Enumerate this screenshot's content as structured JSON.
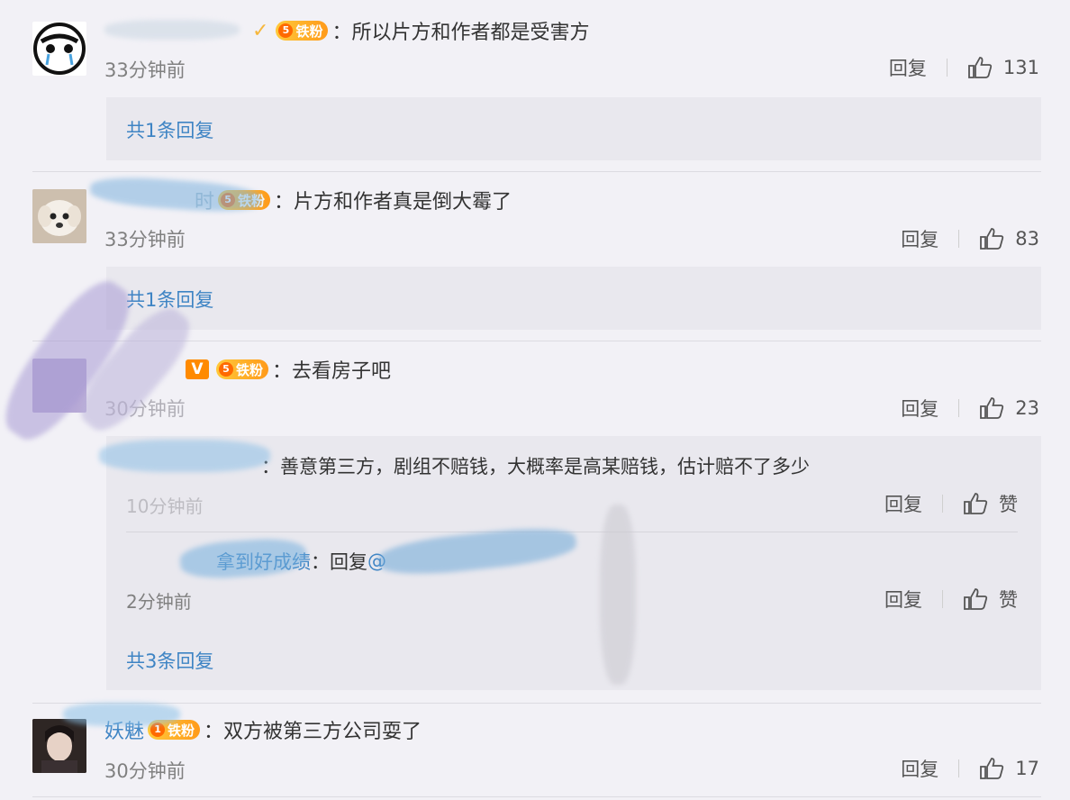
{
  "colors": {
    "link": "#3e84c4",
    "username": "#eb7350",
    "time": "#808080",
    "fan_badge": "#ffa020"
  },
  "comments": [
    {
      "username": "",
      "username_partial": "",
      "badges": {
        "verified_check": true,
        "fan_level": "5",
        "fan_label": "铁粉"
      },
      "text": "：所以片方和作者都是受害方",
      "time": "33分钟前",
      "reply_label": "回复",
      "likes": "131",
      "reply_count": "共1条回复"
    },
    {
      "username": "时",
      "badges": {
        "fan_level": "5",
        "fan_label": "铁粉"
      },
      "text": "：片方和作者真是倒大霉了",
      "time": "33分钟前",
      "reply_label": "回复",
      "likes": "83",
      "reply_count": "共1条回复"
    },
    {
      "username": "",
      "badges": {
        "vip": "V",
        "fan_level": "5",
        "fan_label": "铁粉"
      },
      "text": "：去看房子吧",
      "time": "30分钟前",
      "reply_label": "回复",
      "likes": "23",
      "sub_replies": [
        {
          "username": "",
          "text": "：善意第三方，剧组不赔钱，大概率是高某赔钱，估计赔不了多少",
          "time": "10分钟前",
          "reply_label": "回复",
          "like_label": "赞"
        },
        {
          "username": "拿到好成绩",
          "text": "：回复",
          "mention": "@",
          "time": "2分钟前",
          "reply_label": "回复",
          "like_label": "赞"
        }
      ],
      "reply_count": "共3条回复"
    },
    {
      "username": "妖魅",
      "badges": {
        "fan_level": "1",
        "fan_label": "铁粉"
      },
      "text": "：双方被第三方公司耍了",
      "time": "30分钟前",
      "reply_label": "回复",
      "likes": "17"
    }
  ]
}
